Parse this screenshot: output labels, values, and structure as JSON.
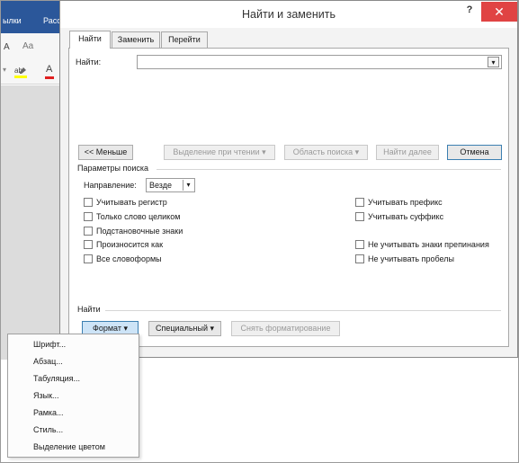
{
  "background_app": {
    "tabs": [
      "ылки",
      "Расс"
    ],
    "font_size_icon": "A",
    "aa_icon": "Aa",
    "font_color_icon": "A"
  },
  "dialog": {
    "title": "Найти и заменить",
    "help": "?",
    "close": "✕",
    "tabs": [
      {
        "label": "Найти",
        "active": true
      },
      {
        "label": "Заменить",
        "active": false
      },
      {
        "label": "Перейти",
        "active": false
      }
    ],
    "find_label": "Найти:",
    "find_value": "",
    "buttons": {
      "less": "<< Меньше",
      "reading_highlight": "Выделение при чтении ▾",
      "search_area": "Область поиска ▾",
      "find_next": "Найти далее",
      "cancel": "Отмена"
    },
    "search_options": {
      "title": "Параметры поиска",
      "direction_label": "Направление:",
      "direction_value": "Везде",
      "left_checks": [
        "Учитывать регистр",
        "Только слово целиком",
        "Подстановочные знаки",
        "Произносится как",
        "Все словоформы"
      ],
      "right_checks": [
        "Учитывать префикс",
        "Учитывать суффикс",
        "Не учитывать знаки препинания",
        "Не учитывать пробелы"
      ]
    },
    "find_section": {
      "title": "Найти",
      "format": "Формат ▾",
      "special": "Специальный ▾",
      "clear_formatting": "Снять форматирование"
    }
  },
  "format_menu": {
    "items": [
      "Шрифт...",
      "Абзац...",
      "Табуляция...",
      "Язык...",
      "Рамка...",
      "Стиль...",
      "Выделение цветом"
    ]
  },
  "colors": {
    "ribbon_blue": "#2b579a",
    "close_red": "#e04343",
    "format_button_bg": "#cde4f7",
    "accent_border": "#3c7fb1"
  }
}
